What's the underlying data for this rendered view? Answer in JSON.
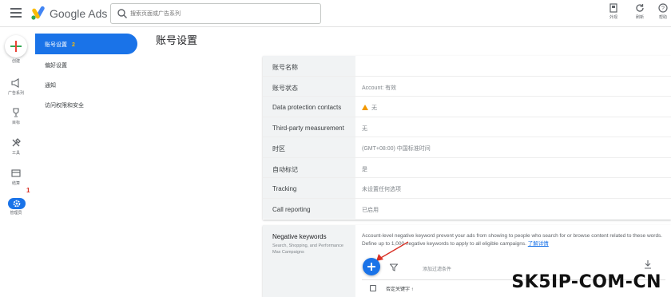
{
  "app": {
    "brand": "Google Ads",
    "search_placeholder": "搜索页面或广告系列"
  },
  "toolbar": [
    {
      "label": "外观",
      "icon": "appearance-icon"
    },
    {
      "label": "刷新",
      "icon": "refresh-icon"
    },
    {
      "label": "帮助",
      "icon": "help-icon"
    }
  ],
  "rail": {
    "create_label": "创建",
    "items": [
      {
        "label": "广告系列",
        "icon": "campaign-icon"
      },
      {
        "label": "目标",
        "icon": "goals-icon"
      },
      {
        "label": "工具",
        "icon": "tools-icon"
      },
      {
        "label": "结算",
        "icon": "billing-icon"
      },
      {
        "label": "管理员",
        "icon": "admin-gear-icon"
      }
    ],
    "annotation": "1"
  },
  "subnav": {
    "items": [
      {
        "label": "账号设置",
        "badge": "2"
      },
      {
        "label": "偏好设置"
      },
      {
        "label": "通知"
      },
      {
        "label": "访问权限和安全"
      }
    ]
  },
  "page_title": "账号设置",
  "settings": [
    {
      "label": "账号名称",
      "value": ""
    },
    {
      "label": "账号状态",
      "value": "Account: 有效"
    },
    {
      "label": "Data protection contacts",
      "value": "无",
      "warning": true
    },
    {
      "label": "Third-party measurement",
      "value": "无"
    },
    {
      "label": "时区",
      "value": "(GMT+08:00) 中国标准时间"
    },
    {
      "label": "自动标记",
      "value": "是"
    },
    {
      "label": "Tracking",
      "value": "未设置任何选项"
    },
    {
      "label": "Call reporting",
      "value": "已启用"
    }
  ],
  "negative_keywords": {
    "title": "Negative keywords",
    "subtitle": "Search, Shopping, and Performance Max Campaigns",
    "description": "Account-level negative keyword prevent your ads from showing to people who search for or browse content related to these words. Define up to 1,000 negative keywords to apply to all eligible campaigns.",
    "link": "了解详情",
    "filter_label": "添加过滤条件",
    "column_header": "否定关键字 ↑"
  },
  "watermark": "SK5IP-COM-CN",
  "colors": {
    "accent": "#1a73e8",
    "warning": "#f29900"
  }
}
